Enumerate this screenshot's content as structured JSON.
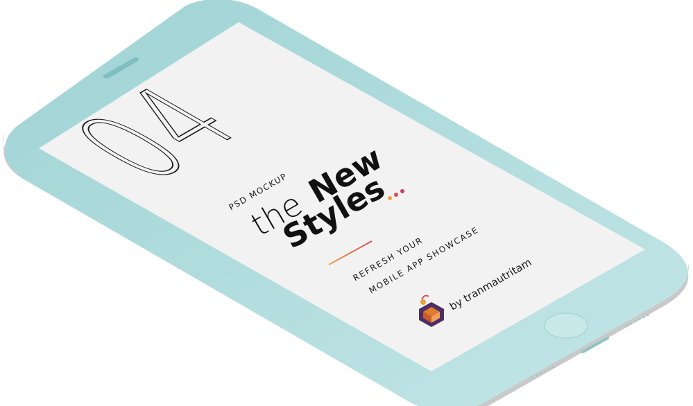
{
  "screen": {
    "number": "04",
    "label": "PSD MOCKUP",
    "headline_thin": "the",
    "headline_bold": "New",
    "headline_line2": "Styles",
    "tagline_line1": "REFRESH YOUR",
    "tagline_line2": "MOBILE APP SHOWCASE",
    "byline": "by tranmautritam"
  },
  "colors": {
    "phone_body": "#b4dfdf",
    "screen_bg": "#f2f2f2",
    "side_edge": "#c9c9c9",
    "dot_1": "#e7a54a",
    "dot_2": "#e0465c",
    "dot_3": "#c93a6e",
    "logo_primary": "#4b2f66",
    "logo_accent": "#e07b2c"
  },
  "icons": {
    "logo": "hexagon-cube-logo",
    "speaker": "earpiece-speaker",
    "home": "home-button"
  }
}
